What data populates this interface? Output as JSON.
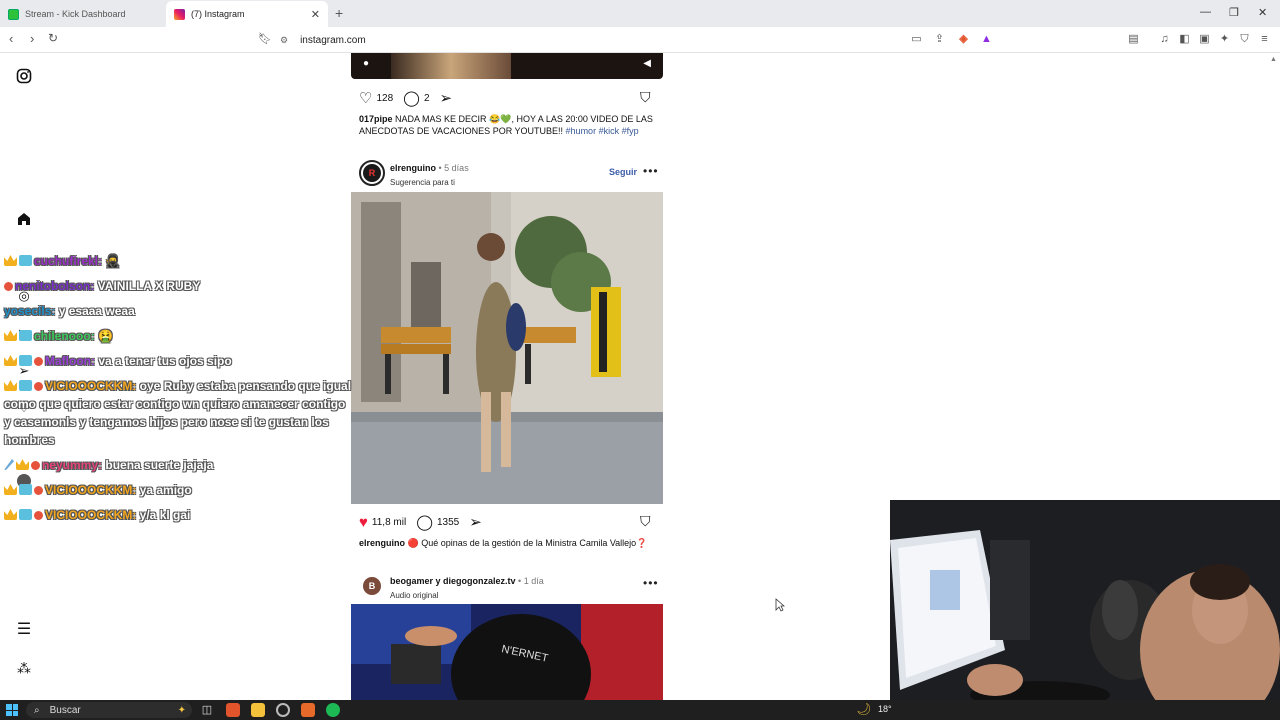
{
  "browser": {
    "tabs": [
      {
        "title": "Stream - Kick Dashboard",
        "active": false
      },
      {
        "title": "(7) Instagram",
        "active": true
      }
    ],
    "new_tab": "+",
    "url": "instagram.com",
    "window_controls": {
      "minimize": "—",
      "restore": "❐",
      "close": "✕"
    }
  },
  "sidebar": {
    "icons": [
      "instagram-icon",
      "home-icon",
      "search-icon",
      "explore-icon",
      "reels-icon",
      "messages-icon",
      "notifications-icon",
      "profile-icon",
      "menu-icon",
      "more-icon"
    ]
  },
  "feed": {
    "post1": {
      "likes": "128",
      "comments": "2",
      "caption_user": "017pipe",
      "caption_text": " NADA MAS KE DECIR 😂💚, HOY A LAS 20:00 VIDEO DE LAS ANECDOTAS DE VACACIONES POR YOUTUBE!! ",
      "hashtags": "#humor #kick #fyp"
    },
    "post2": {
      "user": "elrenguino",
      "time": "5 días",
      "subtitle": "Sugerencia para ti",
      "follow": "Seguir",
      "likes": "11,8 mil",
      "comments": "1355",
      "caption_user": "elrenguino",
      "caption_text": " 🔴 Qué opinas de la gestión de la Ministra Camila Vallejo❓"
    },
    "post3": {
      "user": "beogamer y diegogonzalez.tv",
      "time": "1 día",
      "subtitle": "Audio original"
    }
  },
  "chat": [
    {
      "user": "cuchufirekl:",
      "message": " 🥷",
      "user_color": "#9b2fc9",
      "badges": [
        "crown",
        "cube"
      ]
    },
    {
      "user": "nenitobolson:",
      "message": " VAINILLA X RUBY",
      "user_color": "#7a2fc9",
      "badges": [
        "sub"
      ]
    },
    {
      "user": "yosecils:",
      "message": " y esaaa weaa",
      "user_color": "#1d8fc9",
      "badges": []
    },
    {
      "user": "chilenooo:",
      "message": " 🤮",
      "user_color": "#3cc95a",
      "badges": [
        "crown",
        "cube"
      ]
    },
    {
      "user": "Mafloon:",
      "message": " va a tener tus ojos sipo",
      "user_color": "#9b3fd9",
      "badges": [
        "crown",
        "cube",
        "sub"
      ]
    },
    {
      "user": "VICIOOOCKKM:",
      "message": " oye Ruby estaba pensando que igual como que quiero estar contigo wn quiero amanecer contigo y casemonls y tengamos hijos pero nose si te gustan los hombres",
      "user_color": "#f2a51e",
      "badges": [
        "crown",
        "cube",
        "sub"
      ]
    },
    {
      "user": "neyummy:",
      "message": " buena suerte jajaja",
      "user_color": "#e5417a",
      "badges": [
        "sword",
        "crown",
        "sub"
      ]
    },
    {
      "user": "VICIOOOCKKM:",
      "message": " ya amigo",
      "user_color": "#f2a51e",
      "badges": [
        "crown",
        "cube",
        "sub"
      ]
    },
    {
      "user": "VICIOOOCKKM:",
      "message": " y/a kl gai",
      "user_color": "#f2a51e",
      "badges": [
        "crown",
        "cube",
        "sub"
      ]
    }
  ],
  "taskbar": {
    "search_placeholder": "Buscar",
    "temperature": "18°"
  }
}
